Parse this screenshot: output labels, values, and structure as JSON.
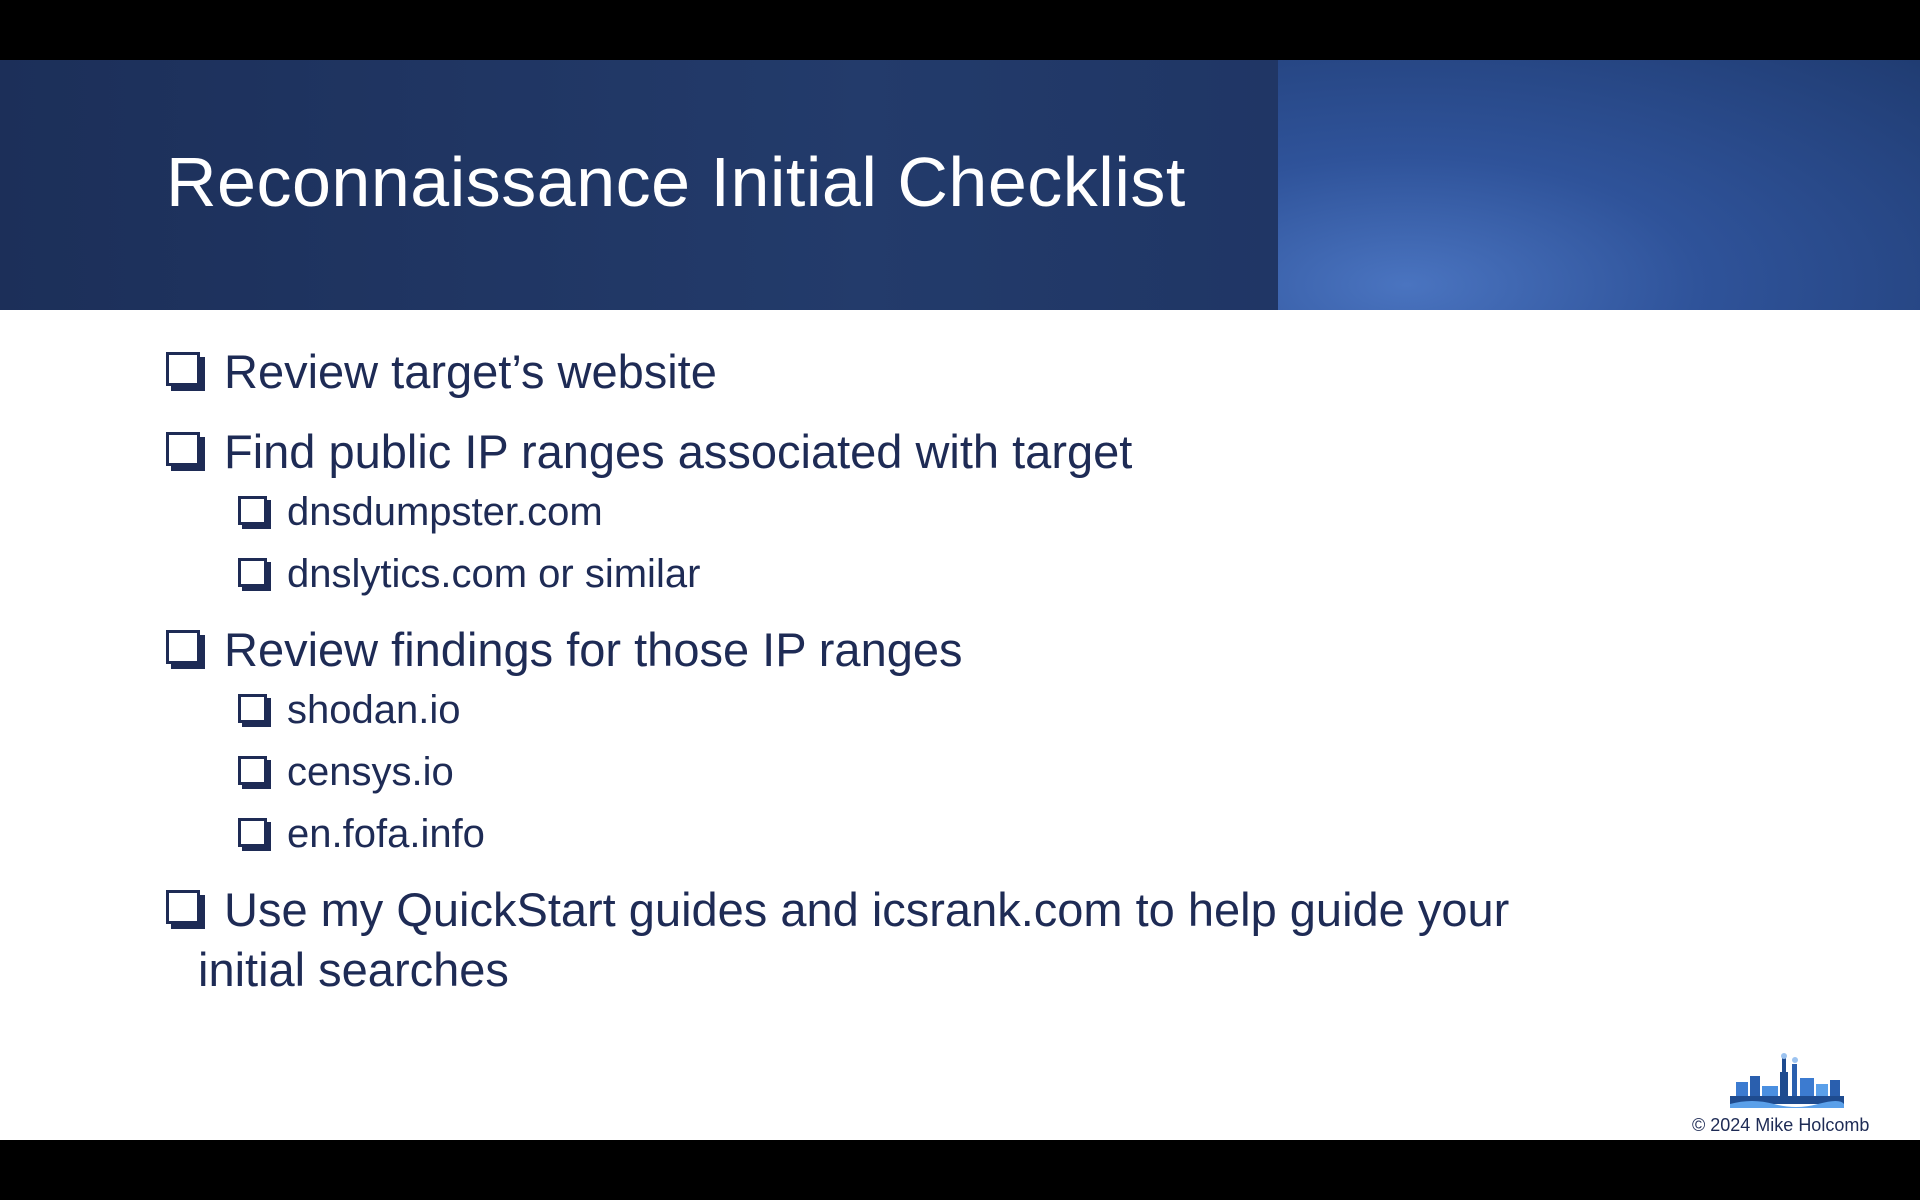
{
  "slide": {
    "title": "Reconnaissance Initial Checklist",
    "items": [
      {
        "text": "Review target’s website"
      },
      {
        "text": "Find public IP ranges associated with target"
      },
      {
        "text": "dnsdumpster.com"
      },
      {
        "text": "dnslytics.com or similar"
      },
      {
        "text": "Review findings for those IP ranges"
      },
      {
        "text": "shodan.io"
      },
      {
        "text": "censys.io"
      },
      {
        "text": "en.fofa.info"
      },
      {
        "text_line1": "Use my QuickStart guides and icsrank.com to help guide your",
        "text_line2": "initial searches"
      }
    ],
    "copyright": "© 2024 Mike Holcomb",
    "checkbox_icon": "checkbox-unchecked-icon",
    "logo_icon": "factory-skyline-logo"
  },
  "colors": {
    "title_band": "#1c2f59",
    "title_band_accent": "#4a74c0",
    "text": "#1e2b55",
    "background": "#ffffff"
  }
}
